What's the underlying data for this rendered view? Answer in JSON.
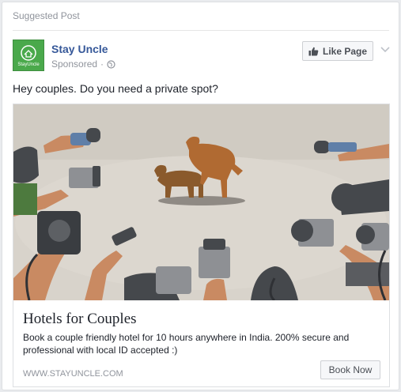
{
  "post": {
    "suggested_label": "Suggested Post",
    "page_name": "Stay Uncle",
    "logo_text": "StayUncle",
    "sponsored_label": "Sponsored",
    "like_page_label": "Like Page",
    "text": "Hey couples. Do you need a private spot?"
  },
  "ad": {
    "headline": "Hotels for Couples",
    "description": "Book a couple friendly hotel for 10 hours anywhere in India. 200% secure and professional with local ID accepted :)",
    "url": "WWW.STAYUNCLE.COM",
    "cta_label": "Book Now"
  },
  "icons": {
    "logo": "hotel-logo-icon",
    "globe": "globe-icon",
    "like": "thumbs-up-icon",
    "menu": "chevron-down-icon"
  },
  "colors": {
    "brand_green": "#4aa94b",
    "link_blue": "#365899",
    "meta_gray": "#90949c"
  }
}
